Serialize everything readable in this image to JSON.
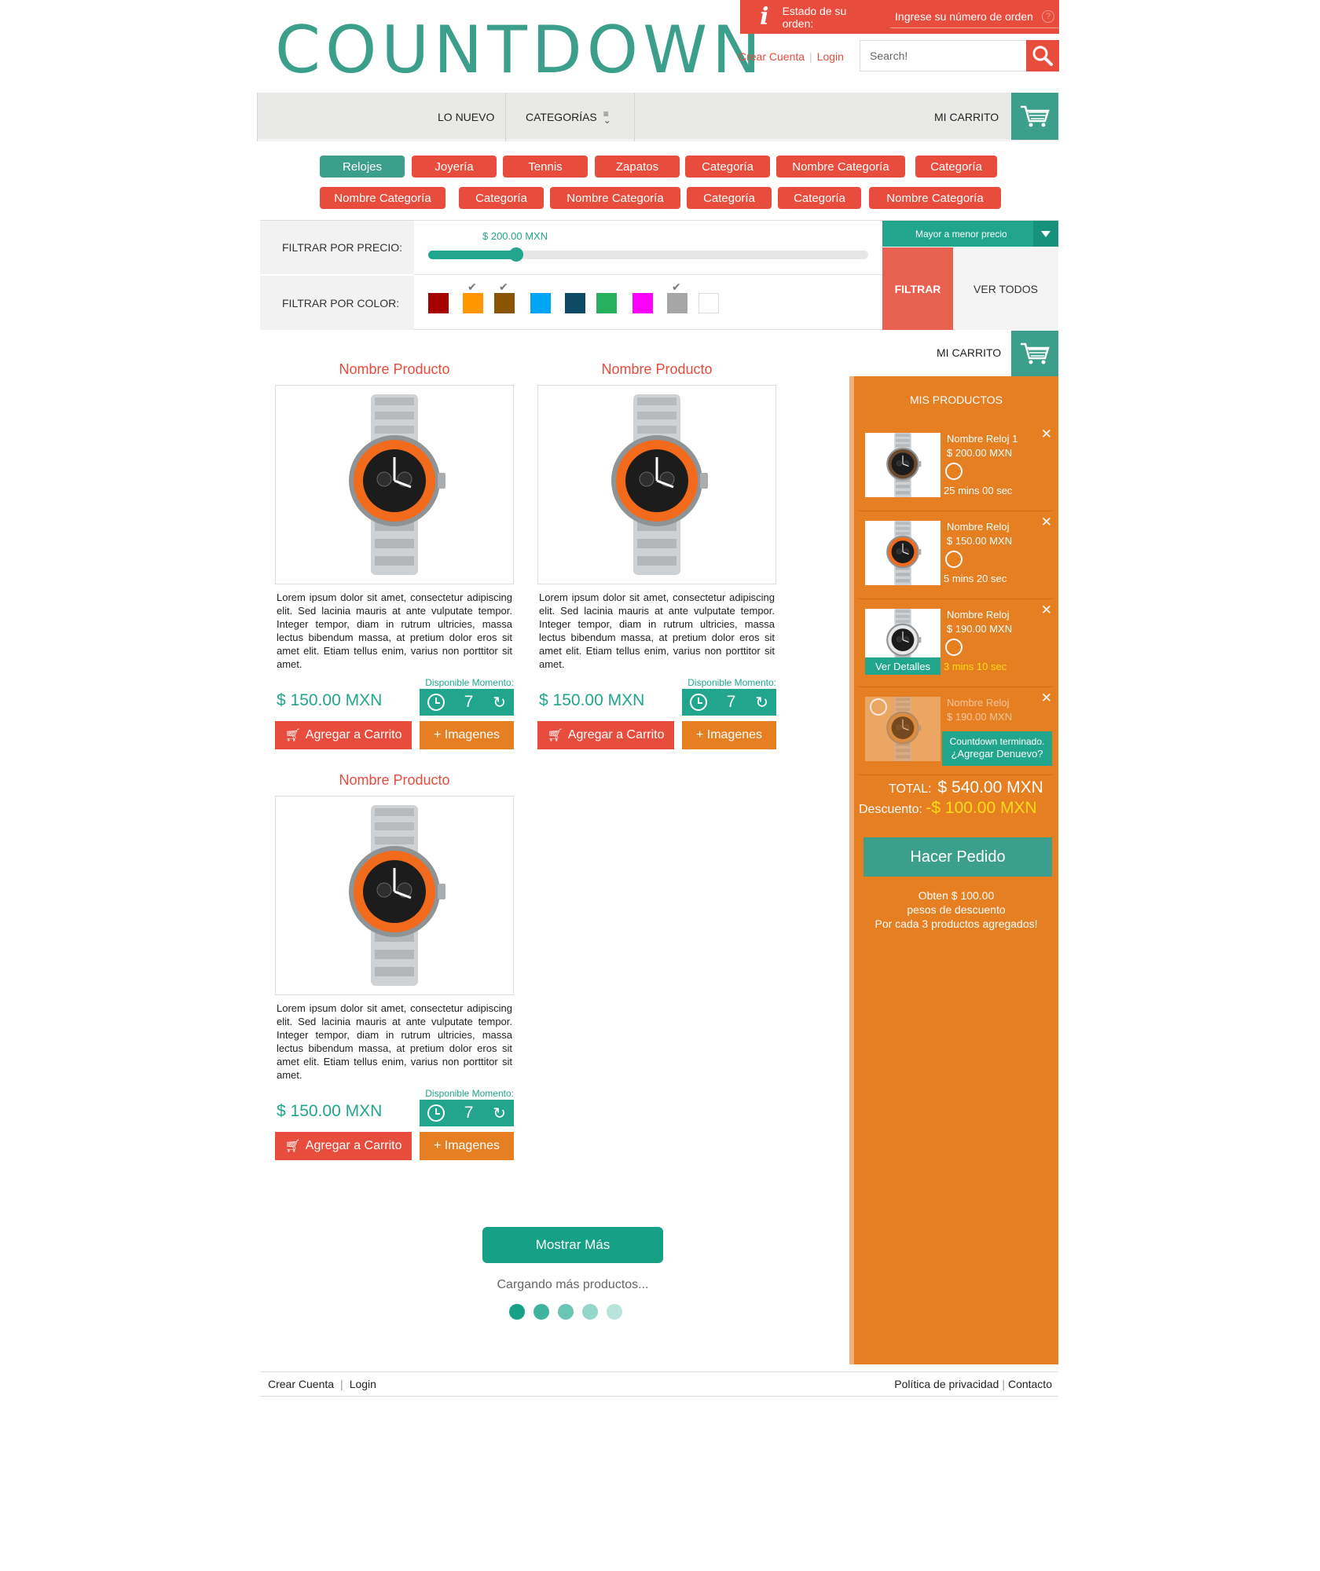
{
  "brand": {
    "logo_text": "COUNTDOWN",
    "color": "#3c9f8c"
  },
  "order_status": {
    "label": "Estado de su orden:",
    "placeholder": "Ingrese su número de orden",
    "icon": "info-icon",
    "help_icon": "help-icon"
  },
  "account": {
    "create": "Crear Cuenta",
    "login": "Login"
  },
  "search": {
    "placeholder": "Search!",
    "icon": "search-icon"
  },
  "nav": {
    "new": "LO NUEVO",
    "categories": "CATEGORÍAS",
    "cart": "MI CARRITO"
  },
  "categories_row1": [
    "Relojes",
    "Joyería",
    "Tennis",
    "Zapatos",
    "Categoría",
    "Nombre Categoría",
    "Categoría"
  ],
  "categories_row2": [
    "Nombre Categoría",
    "Categoría",
    "Nombre Categoría",
    "Categoría",
    "Categoría",
    "Nombre Categoría"
  ],
  "active_category": "Relojes",
  "filter": {
    "price_label": "FILTRAR POR PRECIO:",
    "price_value": "$ 200.00 MXN",
    "price_fraction": 0.2,
    "color_label": "FILTRAR POR COLOR:",
    "colors": [
      {
        "hex": "#a60000",
        "checked": false
      },
      {
        "hex": "#ff9600",
        "checked": true
      },
      {
        "hex": "#8b5400",
        "checked": true
      },
      {
        "hex": "#00a6f5",
        "checked": false
      },
      {
        "hex": "#0c4a66",
        "checked": false
      },
      {
        "hex": "#27b15f",
        "checked": false
      },
      {
        "hex": "#ff00ff",
        "checked": false
      },
      {
        "hex": "#a6a6a6",
        "checked": true
      },
      {
        "hex": "#ffffff",
        "checked": false
      }
    ],
    "sort": "Mayor a menor precio",
    "filter_btn": "FILTRAR",
    "all_btn": "VER TODOS"
  },
  "products": [
    {
      "name": "Nombre Producto",
      "desc": "Lorem ipsum dolor sit amet, consectetur adipiscing elit. Sed lacinia mauris at ante vulputate tempor. Integer tempor, diam in rutrum ultricies, massa lectus bibendum massa, at pretium dolor eros sit amet elit. Etiam tellus enim, varius non porttitor sit amet.",
      "avail": "Disponible Momento:",
      "price": "$ 150.00 MXN",
      "count": "7",
      "cart_btn": "Agregar a Carrito",
      "img_btn": "+ Imagenes"
    },
    {
      "name": "Nombre Producto",
      "desc": "Lorem ipsum dolor sit amet, consectetur adipiscing elit. Sed lacinia mauris at ante vulputate tempor. Integer tempor, diam in rutrum ultricies, massa lectus bibendum massa, at pretium dolor eros sit amet elit. Etiam tellus enim, varius non porttitor sit amet.",
      "avail": "Disponible Momento:",
      "price": "$ 150.00 MXN",
      "count": "7",
      "cart_btn": "Agregar a Carrito",
      "img_btn": "+ Imagenes"
    },
    {
      "name": "Nombre Producto",
      "desc": "Lorem ipsum dolor sit amet, consectetur adipiscing elit. Sed lacinia mauris at ante vulputate tempor. Integer tempor, diam in rutrum ultricies, massa lectus bibendum massa, at pretium dolor eros sit amet elit. Etiam tellus enim, varius non porttitor sit amet.",
      "avail": "Disponible Momento:",
      "price": "$ 150.00 MXN",
      "count": "7",
      "cart_btn": "Agregar a Carrito",
      "img_btn": "+ Imagenes"
    }
  ],
  "cart": {
    "header": "MI CARRITO",
    "title": "MIS PRODUCTOS",
    "items": [
      {
        "name": "Nombre Reloj 1",
        "price": "$ 200.00 MXN",
        "time": "25 mins 00 sec",
        "warn": false
      },
      {
        "name": "Nombre Reloj",
        "price": "$ 150.00 MXN",
        "time": "5 mins 20 sec",
        "warn": false
      },
      {
        "name": "Nombre Reloj",
        "price": "$ 190.00 MXN",
        "time": "3 mins 10 sec",
        "warn": true,
        "details_btn": "Ver Detalles"
      },
      {
        "name": "Nombre Reloj",
        "price": "$ 190.00 MXN",
        "time": "",
        "warn": false,
        "expired": "Countdown terminado.",
        "readd": "¿Agregar Denuevo?"
      }
    ],
    "total_label": "TOTAL:",
    "total": "$ 540.00 MXN",
    "discount_label": "Descuento:",
    "discount": "-$ 100.00 MXN",
    "order_btn": "Hacer Pedido",
    "promo": [
      "Obten $ 100.00",
      "pesos de descuento",
      "Por cada 3 productos agregados!"
    ]
  },
  "more": {
    "button": "Mostrar Más",
    "loading": "Cargando más productos..."
  },
  "footer": {
    "create": "Crear Cuenta",
    "login": "Login",
    "privacy": "Política de privacidad",
    "contact": "Contacto"
  }
}
